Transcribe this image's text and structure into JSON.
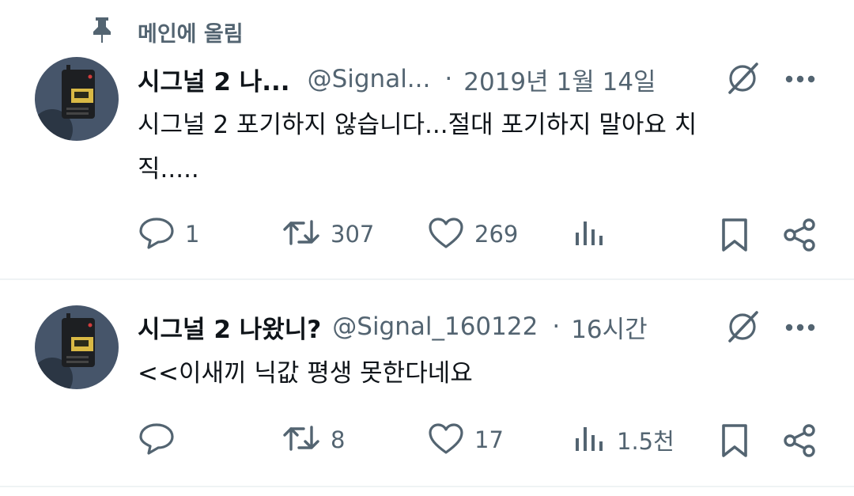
{
  "pinned": {
    "label": "메인에 올림"
  },
  "tweets": [
    {
      "name": "시그널 2 나...",
      "handle": "@Signal...",
      "time": "2019년 1월 14일",
      "lines": [
        "시그널 2 포기하지 않습니다...절대 포기하지 말아요 치",
        "직....."
      ],
      "replies": "1",
      "retweets": "307",
      "likes": "269",
      "views": ""
    },
    {
      "name": "시그널 2 나왔니?",
      "handle": "@Signal_160122",
      "time": "16시간",
      "lines": [
        "<<이새끼 닉값 평생 못한다네요"
      ],
      "replies": "",
      "retweets": "8",
      "likes": "17",
      "views": "1.5천"
    }
  ],
  "separator": "·",
  "icons": [
    "pin-icon",
    "grok-icon",
    "more-icon",
    "reply-icon",
    "retweet-icon",
    "like-icon",
    "views-icon",
    "bookmark-icon",
    "share-icon"
  ],
  "colors": {
    "text": "#0f1419",
    "secondary": "#536471",
    "divider": "#eff3f4"
  }
}
